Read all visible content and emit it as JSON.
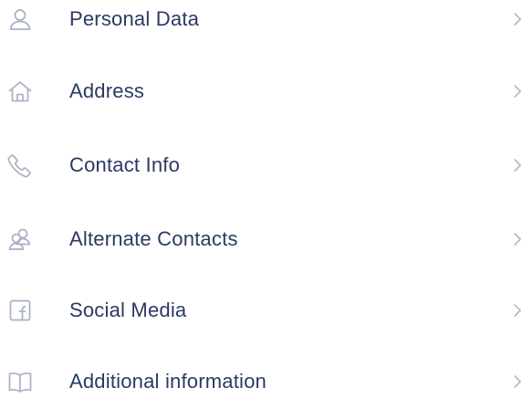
{
  "menu": {
    "items": [
      {
        "label": "Personal Data",
        "icon": "person-icon"
      },
      {
        "label": "Address",
        "icon": "home-icon"
      },
      {
        "label": "Contact Info",
        "icon": "phone-icon"
      },
      {
        "label": "Alternate Contacts",
        "icon": "contacts-icon"
      },
      {
        "label": "Social Media",
        "icon": "facebook-icon"
      },
      {
        "label": "Additional information",
        "icon": "book-icon"
      }
    ]
  },
  "colors": {
    "label": "#2c3a63",
    "icon": "#aab0c6",
    "chevron": "#b3b8c9",
    "background": "#ffffff"
  }
}
